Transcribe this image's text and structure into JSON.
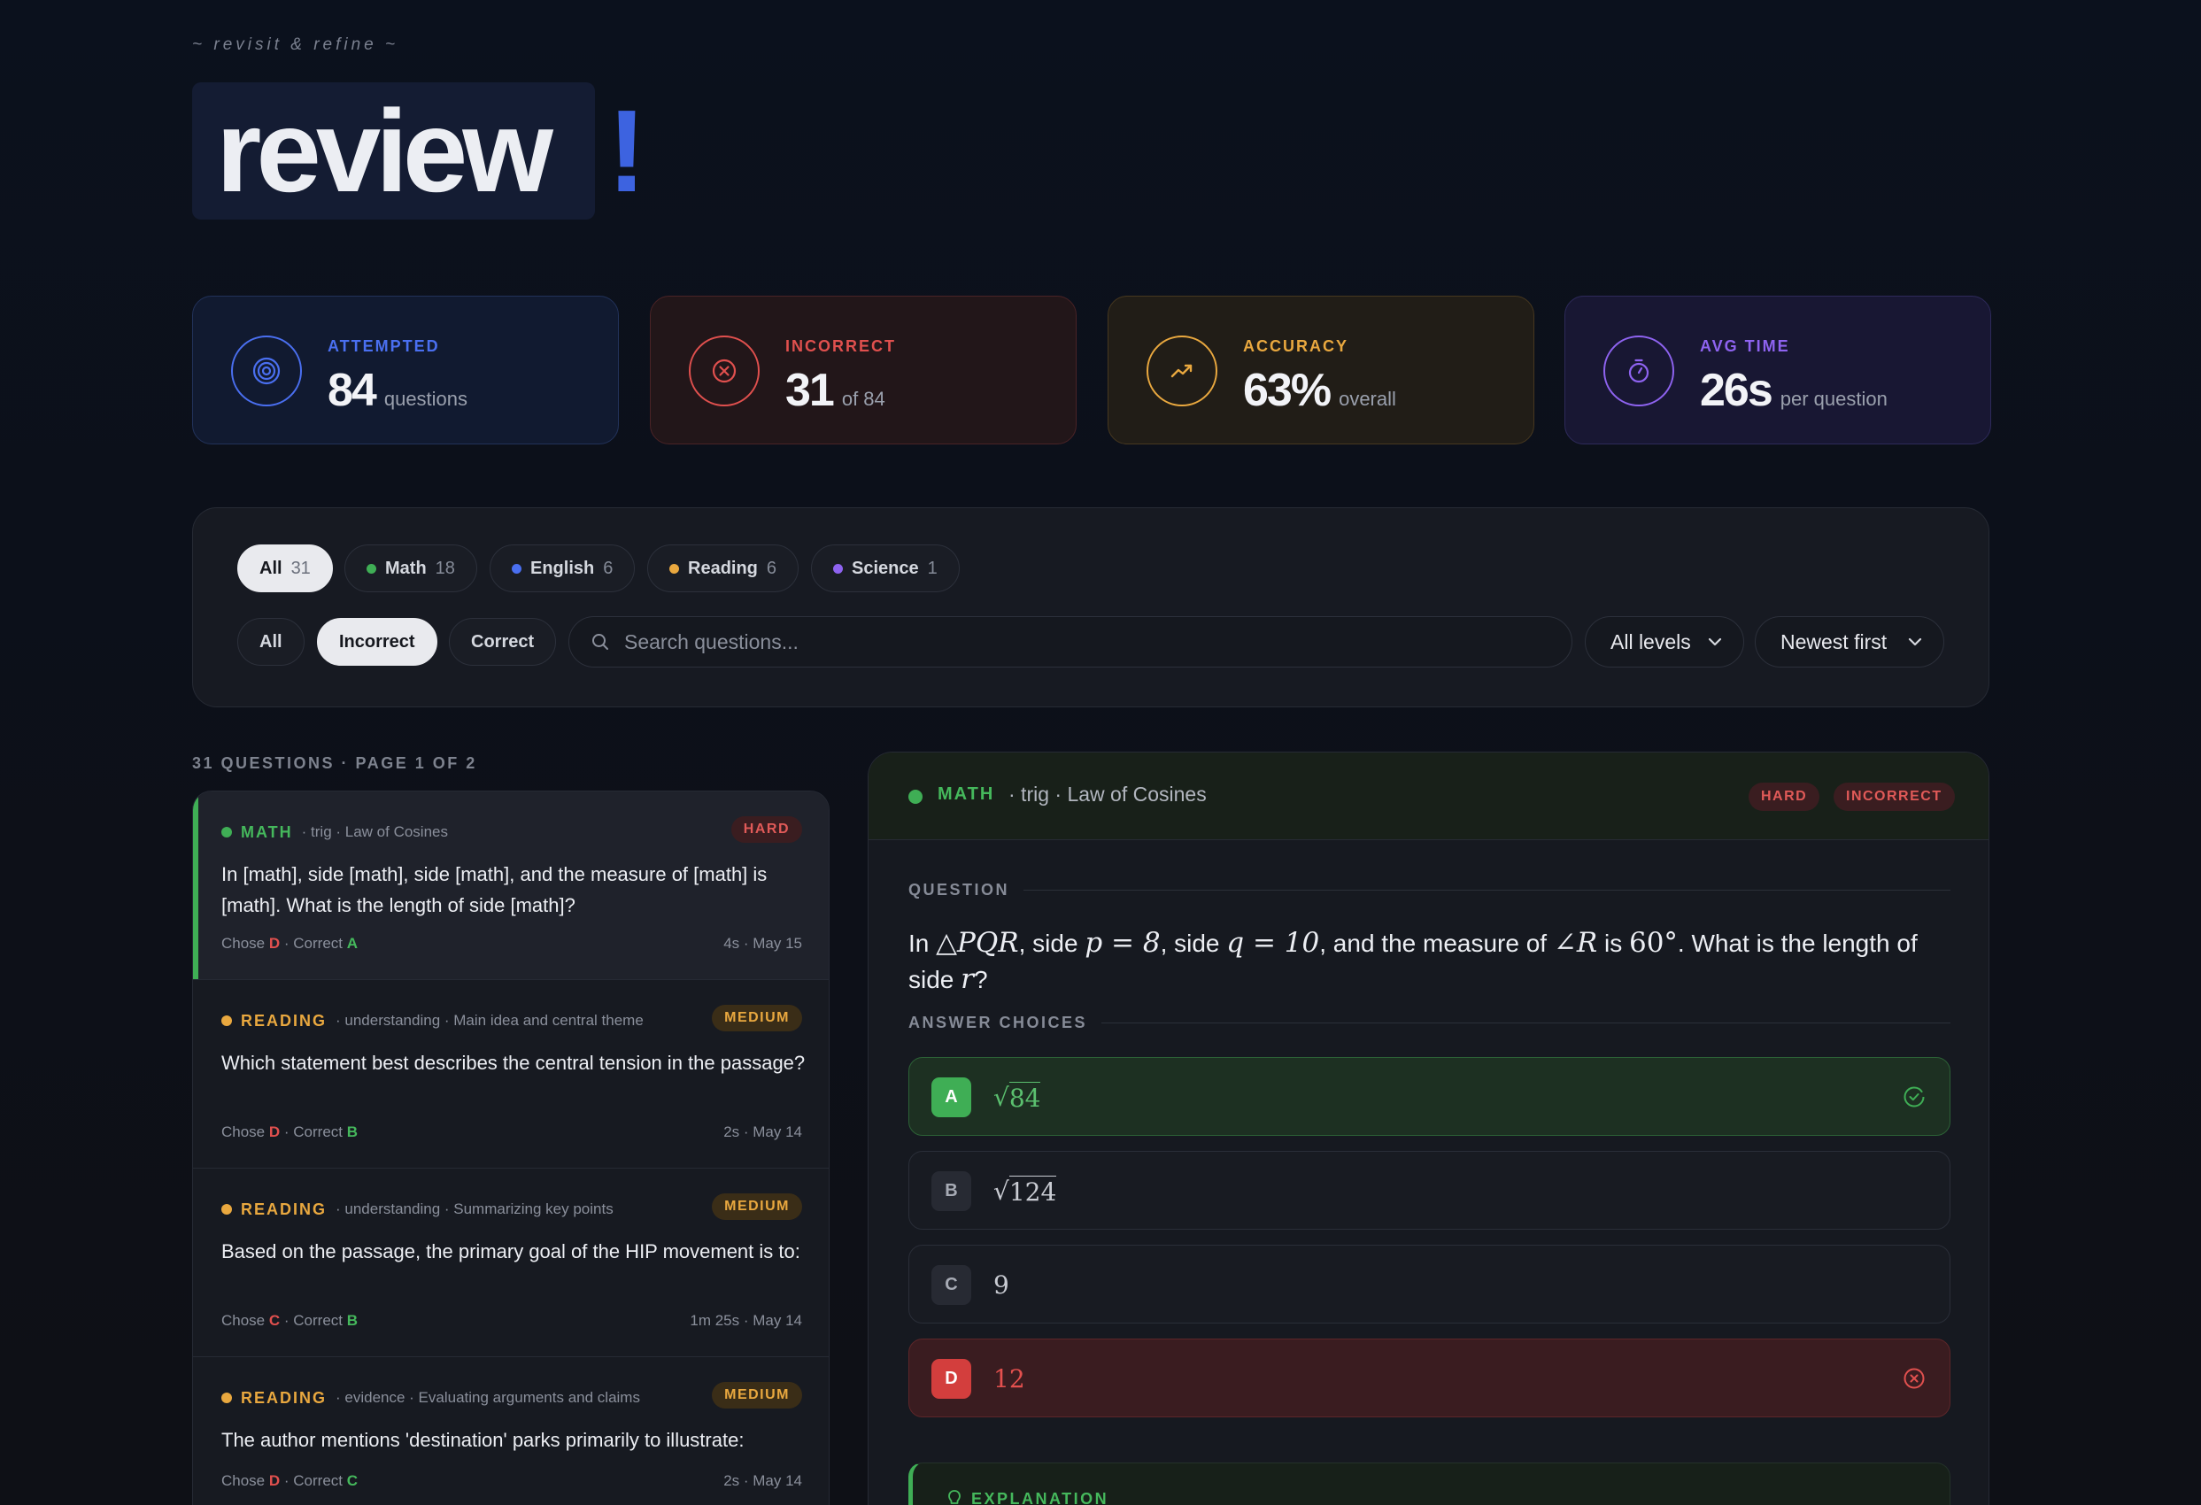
{
  "header": {
    "tagline": "~ revisit & refine ~",
    "title": "review",
    "title_accent": "!"
  },
  "stats": [
    {
      "label": "ATTEMPTED",
      "value": "84",
      "unit": "questions",
      "icon": "target-icon",
      "color": "#4a6ff0"
    },
    {
      "label": "INCORRECT",
      "value": "31",
      "unit": "of 84",
      "icon": "x-circle-icon",
      "color": "#e0504e"
    },
    {
      "label": "ACCURACY",
      "value": "63%",
      "unit": "overall",
      "icon": "trending-up-icon",
      "color": "#e9a83f"
    },
    {
      "label": "AVG TIME",
      "value": "26s",
      "unit": "per question",
      "icon": "stopwatch-icon",
      "color": "#8e63f0"
    }
  ],
  "subject_filters": [
    {
      "label": "All",
      "count": "31",
      "active": true
    },
    {
      "label": "Math",
      "count": "18",
      "color": "#3fae55"
    },
    {
      "label": "English",
      "count": "6",
      "color": "#4a6ff0"
    },
    {
      "label": "Reading",
      "count": "6",
      "color": "#e9a83f"
    },
    {
      "label": "Science",
      "count": "1",
      "color": "#8e63f0"
    }
  ],
  "result_filters": [
    {
      "label": "All"
    },
    {
      "label": "Incorrect",
      "active": true
    },
    {
      "label": "Correct"
    }
  ],
  "search": {
    "placeholder": "Search questions..."
  },
  "level_select": "All levels",
  "sort_select": "Newest first",
  "list": {
    "header": "31 QUESTIONS · PAGE 1 OF 2",
    "items": [
      {
        "subject": "MATH",
        "topic": "· trig · Law of Cosines",
        "difficulty": "HARD",
        "question": "In [math], side [math], side [math], and the measure of [math] is [math]. What is the length of side [math]?",
        "chose_label": "Chose",
        "chose": "D",
        "correct_label": "· Correct",
        "correct": "A",
        "meta": "4s · May 15",
        "color": "#3fae55",
        "subject_color": "#45b85c"
      },
      {
        "subject": "READING",
        "topic": "· understanding · Main idea and central theme",
        "difficulty": "MEDIUM",
        "question": "Which statement best describes the central tension in the passage?",
        "chose_label": "Chose",
        "chose": "D",
        "correct_label": "· Correct",
        "correct": "B",
        "meta": "2s · May 14",
        "color": "#e9a83f",
        "subject_color": "#e9a83f"
      },
      {
        "subject": "READING",
        "topic": "· understanding · Summarizing key points",
        "difficulty": "MEDIUM",
        "question": "Based on the passage, the primary goal of the HIP movement is to:",
        "chose_label": "Chose",
        "chose": "C",
        "correct_label": "· Correct",
        "correct": "B",
        "meta": "1m 25s · May 14",
        "color": "#e9a83f",
        "subject_color": "#e9a83f"
      },
      {
        "subject": "READING",
        "topic": "· evidence · Evaluating arguments and claims",
        "difficulty": "MEDIUM",
        "question": "The author mentions 'destination' parks primarily to illustrate:",
        "chose_label": "Chose",
        "chose": "D",
        "correct_label": "· Correct",
        "correct": "C",
        "meta": "2s · May 14",
        "color": "#e9a83f",
        "subject_color": "#e9a83f"
      }
    ]
  },
  "detail": {
    "subject": "MATH",
    "topic": "· trig · Law of Cosines",
    "badges": [
      "HARD",
      "INCORRECT"
    ],
    "question_label": "QUESTION",
    "question_parts": {
      "p1": "In ",
      "triangle": "△PQR",
      "p2": ", side ",
      "side_p": "p = 8",
      "p3": ", side ",
      "side_q": "q = 10",
      "p4": ", and the measure of ",
      "angle": "∠R",
      "p5": " is ",
      "deg": "60°",
      "p6": ". What is the length of side ",
      "side_r": "r",
      "p7": "?"
    },
    "choices_label": "ANSWER CHOICES",
    "choices": [
      {
        "letter": "A",
        "value": "84",
        "sqrt": true,
        "state": "correct"
      },
      {
        "letter": "B",
        "value": "124",
        "sqrt": true,
        "state": "neutral"
      },
      {
        "letter": "C",
        "value": "9",
        "sqrt": false,
        "state": "neutral"
      },
      {
        "letter": "D",
        "value": "12",
        "sqrt": false,
        "state": "wrong"
      }
    ],
    "explanation_label": "EXPLANATION"
  }
}
